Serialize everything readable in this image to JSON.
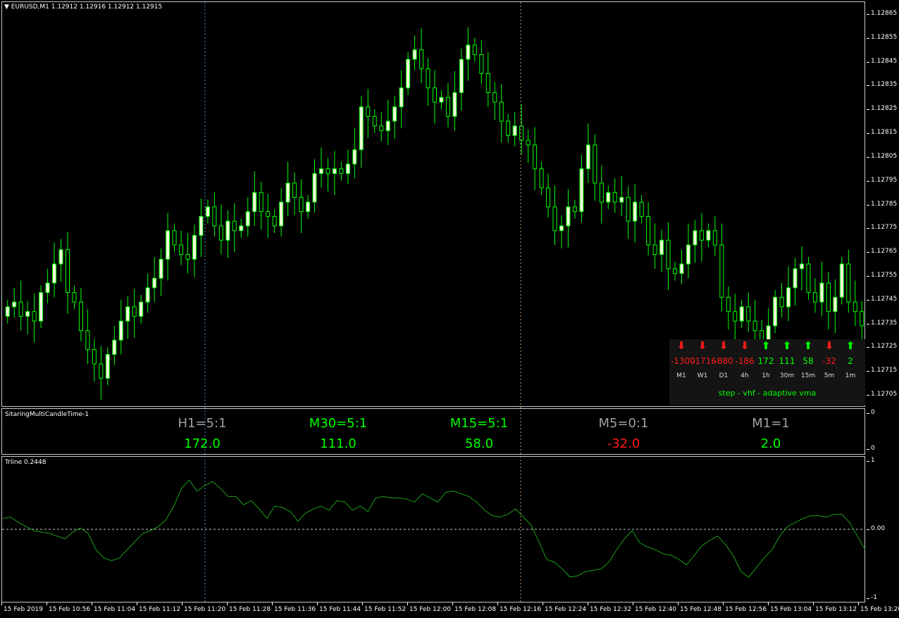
{
  "header": {
    "symbol_label": "EURUSD,M1  1.12912 1.12916 1.12912 1.12915"
  },
  "colors": {
    "background": "#000000",
    "bull_candle": "#f5f5dc",
    "candle_outline": "#00ff00",
    "bear_candle": "#000000",
    "up_color": "#00ff00",
    "down_color": "#ff1a1a",
    "neutral_color": "#a0a0a0",
    "trline_color": "#1a9e1a"
  },
  "panel": {
    "items": [
      {
        "tf": "M1",
        "value": "-1300",
        "dir": "down"
      },
      {
        "tf": "W1",
        "value": "-1716",
        "dir": "down"
      },
      {
        "tf": "D1",
        "value": "-880",
        "dir": "down"
      },
      {
        "tf": "4h",
        "value": "-186",
        "dir": "down"
      },
      {
        "tf": "1h",
        "value": "172",
        "dir": "up"
      },
      {
        "tf": "30m",
        "value": "111",
        "dir": "up"
      },
      {
        "tf": "15m",
        "value": "58",
        "dir": "up"
      },
      {
        "tf": "5m",
        "value": "-32",
        "dir": "down"
      },
      {
        "tf": "1m",
        "value": "2",
        "dir": "up"
      }
    ],
    "caption": "step - vhf - adaptive vma"
  },
  "indicator1": {
    "name": "SitaringMultiCandleTime-1",
    "axis_top": "0",
    "axis_bottom": "0",
    "cells": [
      {
        "ratio": "H1=5:1",
        "ratio_color": "neutral",
        "value": "172.0",
        "value_color": "up"
      },
      {
        "ratio": "M30=5:1",
        "ratio_color": "up",
        "value": "111.0",
        "value_color": "up"
      },
      {
        "ratio": "M15=5:1",
        "ratio_color": "up",
        "value": "58.0",
        "value_color": "up"
      },
      {
        "ratio": "M5=0:1",
        "ratio_color": "neutral",
        "value": "-32.0",
        "value_color": "down"
      },
      {
        "ratio": "M1=1",
        "ratio_color": "neutral",
        "value": "2.0",
        "value_color": "up"
      }
    ]
  },
  "indicator2": {
    "name": "Trline 0.2448",
    "axis_labels": [
      "1",
      "0.00",
      "-1"
    ]
  },
  "chart_data": [
    {
      "type": "candlestick",
      "title": "EURUSD,M1",
      "ylim": [
        1.127,
        1.1287
      ],
      "y_ticks": [
        "1.12865",
        "1.12855",
        "1.12845",
        "1.12835",
        "1.12825",
        "1.12815",
        "1.12805",
        "1.12795",
        "1.12785",
        "1.12775",
        "1.12765",
        "1.12755",
        "1.12745",
        "1.12735",
        "1.12725",
        "1.12715",
        "1.12705"
      ],
      "x_ticks": [
        "15 Feb 2019",
        "15 Feb 10:56",
        "15 Feb 11:04",
        "15 Feb 11:12",
        "15 Feb 11:20",
        "15 Feb 11:28",
        "15 Feb 11:36",
        "15 Feb 11:44",
        "15 Feb 11:52",
        "15 Feb 12:00",
        "15 Feb 12:08",
        "15 Feb 12:16",
        "15 Feb 12:24",
        "15 Feb 12:32",
        "15 Feb 12:40",
        "15 Feb 12:48",
        "15 Feb 12:56",
        "15 Feb 13:04",
        "15 Feb 13:12",
        "15 Feb 13:20"
      ],
      "close_series": [
        1.12742,
        1.12744,
        1.12738,
        1.1274,
        1.12736,
        1.12748,
        1.12752,
        1.1276,
        1.12766,
        1.12748,
        1.12744,
        1.12732,
        1.12724,
        1.12718,
        1.12712,
        1.12722,
        1.12728,
        1.12736,
        1.12742,
        1.12738,
        1.12744,
        1.1275,
        1.12754,
        1.12762,
        1.12774,
        1.12768,
        1.12764,
        1.12762,
        1.12772,
        1.1278,
        1.12784,
        1.12776,
        1.1277,
        1.12778,
        1.12774,
        1.12776,
        1.12782,
        1.1279,
        1.12782,
        1.1278,
        1.12776,
        1.12786,
        1.12794,
        1.12788,
        1.12782,
        1.12786,
        1.12798,
        1.128,
        1.12798,
        1.128,
        1.12798,
        1.12802,
        1.12808,
        1.12826,
        1.12822,
        1.12818,
        1.12816,
        1.1282,
        1.12826,
        1.12834,
        1.12846,
        1.1285,
        1.12842,
        1.12834,
        1.12828,
        1.1283,
        1.12822,
        1.12832,
        1.12846,
        1.12852,
        1.12848,
        1.1284,
        1.12832,
        1.12828,
        1.1282,
        1.12814,
        1.12818,
        1.12812,
        1.1281,
        1.128,
        1.12792,
        1.12784,
        1.12774,
        1.12776,
        1.12784,
        1.12782,
        1.128,
        1.1281,
        1.12794,
        1.12786,
        1.1279,
        1.12786,
        1.12788,
        1.12778,
        1.12786,
        1.1278,
        1.12768,
        1.12764,
        1.1277,
        1.12758,
        1.12756,
        1.1276,
        1.12768,
        1.12774,
        1.1277,
        1.12774,
        1.12768,
        1.12746,
        1.1274,
        1.12736,
        1.12742,
        1.12736,
        1.12732,
        1.12728,
        1.12734,
        1.12746,
        1.12742,
        1.1275,
        1.12758,
        1.1276,
        1.12748,
        1.12744,
        1.12752,
        1.1274,
        1.12746,
        1.1276,
        1.12744,
        1.1274,
        1.12734
      ]
    },
    {
      "type": "line",
      "title": "Trline 0.2448",
      "ylim": [
        -1,
        1
      ],
      "y_ticks": [
        "1",
        "0.00",
        "-1"
      ],
      "series": [
        {
          "values": [
            0.16,
            0.18,
            0.1,
            0.04,
            -0.02,
            -0.04,
            -0.06,
            -0.1,
            -0.14,
            -0.04,
            0.02,
            -0.06,
            -0.3,
            -0.42,
            -0.46,
            -0.42,
            -0.3,
            -0.18,
            -0.06,
            -0.02,
            0.04,
            0.14,
            0.34,
            0.6,
            0.72,
            0.56,
            0.64,
            0.7,
            0.6,
            0.48,
            0.48,
            0.36,
            0.42,
            0.3,
            0.16,
            0.34,
            0.32,
            0.26,
            0.12,
            0.24,
            0.3,
            0.34,
            0.28,
            0.42,
            0.4,
            0.28,
            0.34,
            0.26,
            0.46,
            0.48,
            0.46,
            0.46,
            0.44,
            0.4,
            0.52,
            0.46,
            0.4,
            0.54,
            0.56,
            0.52,
            0.48,
            0.4,
            0.28,
            0.2,
            0.18,
            0.22,
            0.3,
            0.18,
            0.06,
            -0.18,
            -0.44,
            -0.48,
            -0.58,
            -0.7,
            -0.68,
            -0.62,
            -0.6,
            -0.58,
            -0.48,
            -0.3,
            -0.14,
            -0.02,
            -0.2,
            -0.26,
            -0.3,
            -0.36,
            -0.38,
            -0.44,
            -0.52,
            -0.38,
            -0.24,
            -0.16,
            -0.1,
            -0.22,
            -0.38,
            -0.62,
            -0.7,
            -0.56,
            -0.42,
            -0.3,
            -0.1,
            0.04,
            0.1,
            0.16,
            0.2,
            0.2,
            0.18,
            0.22,
            0.22,
            0.1,
            -0.1,
            -0.3
          ]
        }
      ]
    }
  ]
}
